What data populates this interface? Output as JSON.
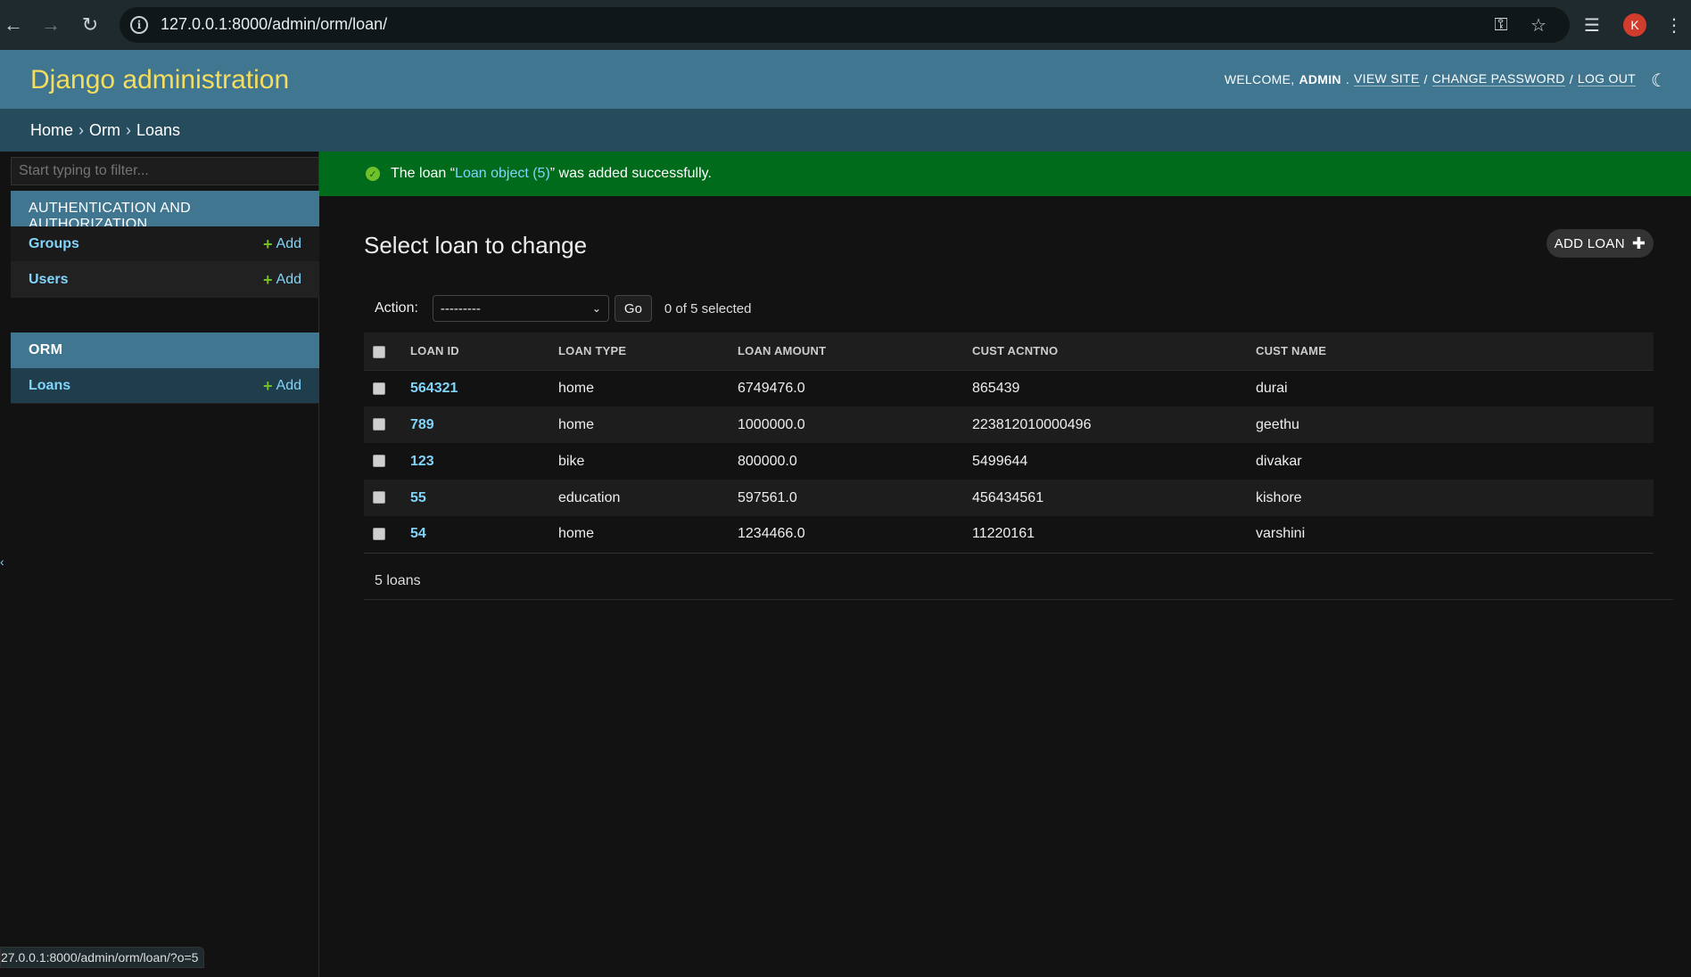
{
  "browser": {
    "url": "127.0.0.1:8000/admin/orm/loan/",
    "profile_initial": "K",
    "status_link": "27.0.0.1:8000/admin/orm/loan/?o=5"
  },
  "header": {
    "site_title": "Django administration",
    "welcome": "WELCOME,",
    "username": "ADMIN",
    "view_site": "VIEW SITE",
    "change_password": "CHANGE PASSWORD",
    "log_out": "LOG OUT"
  },
  "breadcrumbs": {
    "home": "Home",
    "app": "Orm",
    "current": "Loans",
    "separator": "›"
  },
  "sidebar": {
    "filter_placeholder": "Start typing to filter...",
    "apps": [
      {
        "name": "AUTHENTICATION AND AUTHORIZATION",
        "models": [
          {
            "name": "Groups",
            "add": "Add"
          },
          {
            "name": "Users",
            "add": "Add"
          }
        ]
      },
      {
        "name": "ORM",
        "models": [
          {
            "name": "Loans",
            "add": "Add"
          }
        ]
      }
    ]
  },
  "message": {
    "prefix": "The loan “",
    "link": "Loan object (5)",
    "suffix": "” was added successfully."
  },
  "content": {
    "title": "Select loan to change",
    "add_button": "ADD LOAN",
    "action_label": "Action:",
    "action_selected": "---------",
    "go_label": "Go",
    "counter": "0 of 5 selected",
    "columns": [
      "LOAN ID",
      "LOAN TYPE",
      "LOAN AMOUNT",
      "CUST ACNTNO",
      "CUST NAME"
    ],
    "rows": [
      {
        "loan_id": "564321",
        "loan_type": "home",
        "loan_amount": "6749476.0",
        "cust_acntno": "865439",
        "cust_name": "durai"
      },
      {
        "loan_id": "789",
        "loan_type": "home",
        "loan_amount": "1000000.0",
        "cust_acntno": "223812010000496",
        "cust_name": "geethu"
      },
      {
        "loan_id": "123",
        "loan_type": "bike",
        "loan_amount": "800000.0",
        "cust_acntno": "5499644",
        "cust_name": "divakar"
      },
      {
        "loan_id": "55",
        "loan_type": "education",
        "loan_amount": "597561.0",
        "cust_acntno": "456434561",
        "cust_name": "kishore"
      },
      {
        "loan_id": "54",
        "loan_type": "home",
        "loan_amount": "1234466.0",
        "cust_acntno": "11220161",
        "cust_name": "varshini"
      }
    ],
    "paginator": "5 loans"
  },
  "colors": {
    "header_bg": "#417690",
    "site_title": "#f5dd5d",
    "breadcrumb_bg": "#264b5d",
    "success_bg": "#006b1b",
    "link": "#81d4fa",
    "add_plus": "#70bf2b"
  }
}
